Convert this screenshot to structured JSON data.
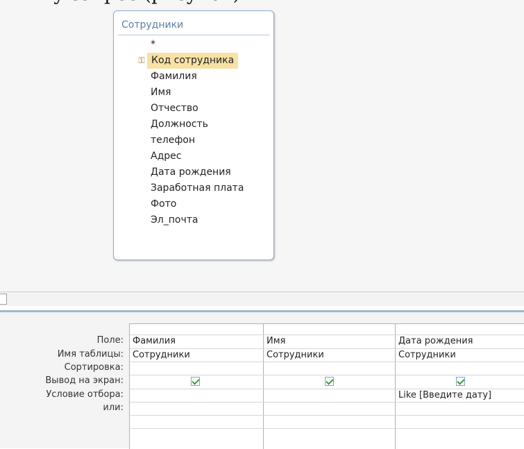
{
  "top_text": "ку запрос (рисунок)",
  "table": {
    "title": "Сотрудники",
    "fields": [
      {
        "label": "*",
        "primary_key": false,
        "selected": false
      },
      {
        "label": "Код сотрудника",
        "primary_key": true,
        "selected": true
      },
      {
        "label": "Фамилия",
        "primary_key": false,
        "selected": false
      },
      {
        "label": "Имя",
        "primary_key": false,
        "selected": false
      },
      {
        "label": "Отчество",
        "primary_key": false,
        "selected": false
      },
      {
        "label": "Должность",
        "primary_key": false,
        "selected": false
      },
      {
        "label": "телефон",
        "primary_key": false,
        "selected": false
      },
      {
        "label": "Адрес",
        "primary_key": false,
        "selected": false
      },
      {
        "label": "Дата рождения",
        "primary_key": false,
        "selected": false
      },
      {
        "label": "Заработная плата",
        "primary_key": false,
        "selected": false
      },
      {
        "label": "Фото",
        "primary_key": false,
        "selected": false
      },
      {
        "label": "Эл_почта",
        "primary_key": false,
        "selected": false
      }
    ],
    "icons": {
      "primary_key": "key-icon"
    }
  },
  "grid": {
    "row_labels": {
      "field": "Поле:",
      "table": "Имя таблицы:",
      "sort": "Сортировка:",
      "show": "Вывод на экран:",
      "criteria": "Условие отбора:",
      "or": "или:"
    },
    "columns": [
      {
        "field": "Фамилия",
        "table": "Сотрудники",
        "sort": "",
        "show": true,
        "criteria": "",
        "or": ""
      },
      {
        "field": "Имя",
        "table": "Сотрудники",
        "sort": "",
        "show": true,
        "criteria": "",
        "or": ""
      },
      {
        "field": "Дата рождения",
        "table": "Сотрудники",
        "sort": "",
        "show": true,
        "criteria": "Like [Введите дату]",
        "or": ""
      }
    ]
  },
  "colors": {
    "selection": "#f7e1a5",
    "window_border": "#8fa9c8",
    "title_text": "#5a7ea8",
    "checkbox_check": "#3a9a3a"
  }
}
